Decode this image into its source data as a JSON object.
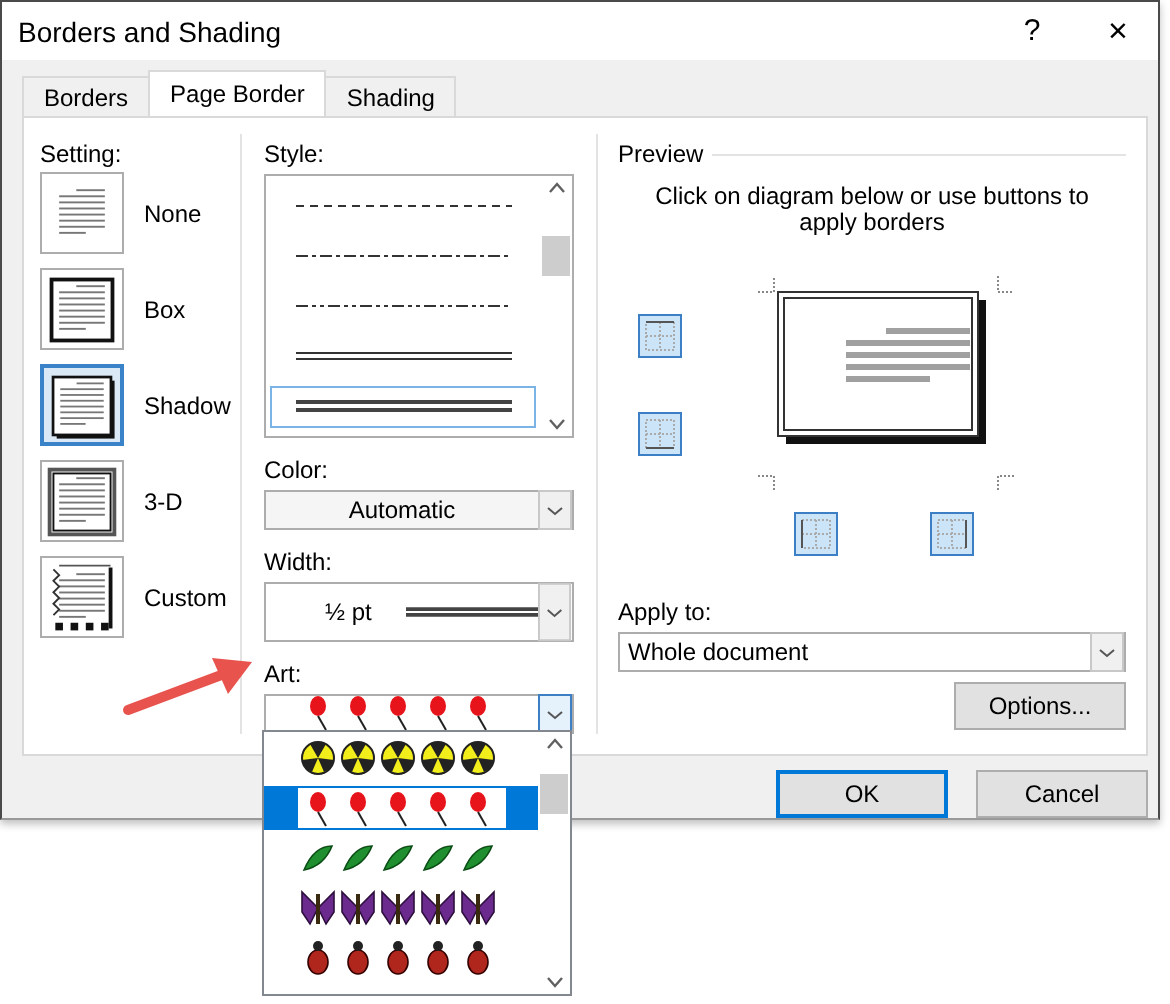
{
  "window": {
    "title": "Borders and Shading",
    "help": "?",
    "close": "×"
  },
  "tabs": [
    {
      "label": "Borders",
      "selected": false
    },
    {
      "label": "Page Border",
      "selected": true
    },
    {
      "label": "Shading",
      "selected": false
    }
  ],
  "setting": {
    "label": "Setting:",
    "items": [
      {
        "kind": "none",
        "label": "None",
        "selected": false
      },
      {
        "kind": "box",
        "label": "Box",
        "selected": false
      },
      {
        "kind": "shadow",
        "label": "Shadow",
        "selected": true
      },
      {
        "kind": "threed",
        "label": "3-D",
        "selected": false
      },
      {
        "kind": "custom",
        "label": "Custom",
        "selected": false
      }
    ]
  },
  "style": {
    "label": "Style:",
    "items": [
      {
        "kind": "dashed",
        "selected": false
      },
      {
        "kind": "dash-dot",
        "selected": false
      },
      {
        "kind": "dash-dot-dot",
        "selected": false
      },
      {
        "kind": "double",
        "selected": false
      },
      {
        "kind": "thick-double",
        "selected": true
      }
    ]
  },
  "color": {
    "label": "Color:",
    "value": "Automatic"
  },
  "width": {
    "label": "Width:",
    "value": "½ pt"
  },
  "art": {
    "label": "Art:",
    "current": {
      "kind": "balloons"
    },
    "options": [
      {
        "kind": "radiation",
        "selected": false
      },
      {
        "kind": "balloons",
        "selected": true
      },
      {
        "kind": "leaves",
        "selected": false
      },
      {
        "kind": "butterflies",
        "selected": false
      },
      {
        "kind": "bugs",
        "selected": false
      }
    ]
  },
  "preview": {
    "title": "Preview",
    "hint": "Click on diagram below or use buttons to apply borders",
    "buttons": [
      {
        "kind": "top",
        "on": true
      },
      {
        "kind": "bottom",
        "on": true
      },
      {
        "kind": "left",
        "on": true
      },
      {
        "kind": "right",
        "on": true
      }
    ]
  },
  "apply_to": {
    "label": "Apply to:",
    "value": "Whole document"
  },
  "options_button": "Options...",
  "buttons": [
    {
      "label": "OK",
      "default": true
    },
    {
      "label": "Cancel",
      "default": false
    }
  ]
}
